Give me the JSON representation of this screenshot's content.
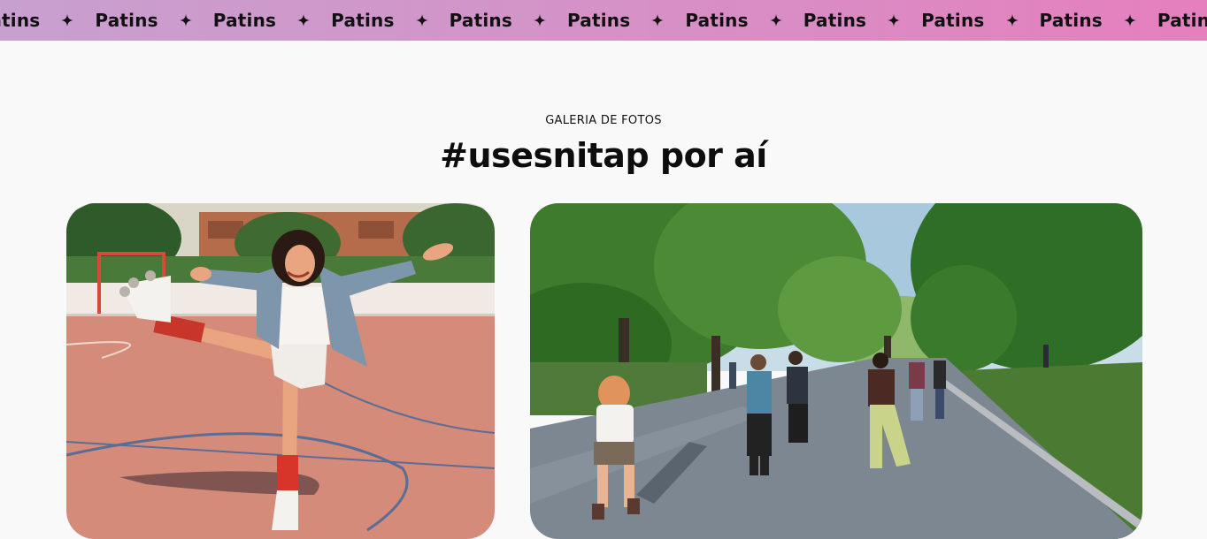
{
  "marquee": {
    "items": [
      "Patins",
      "Patins",
      "Patins",
      "Patins",
      "Patins",
      "Patins",
      "Patins",
      "Patins",
      "Patins",
      "Patins",
      "Patins"
    ],
    "icon": "sparkle-icon",
    "gradient": [
      "#c7a0cf",
      "#e57fbd"
    ]
  },
  "gallery": {
    "eyebrow": "GALERIA DE FOTOS",
    "title": "#usesnitap por aí",
    "photos": [
      {
        "name": "photo-woman-roller-skating-court"
      },
      {
        "name": "photo-group-skating-park-path"
      }
    ]
  }
}
